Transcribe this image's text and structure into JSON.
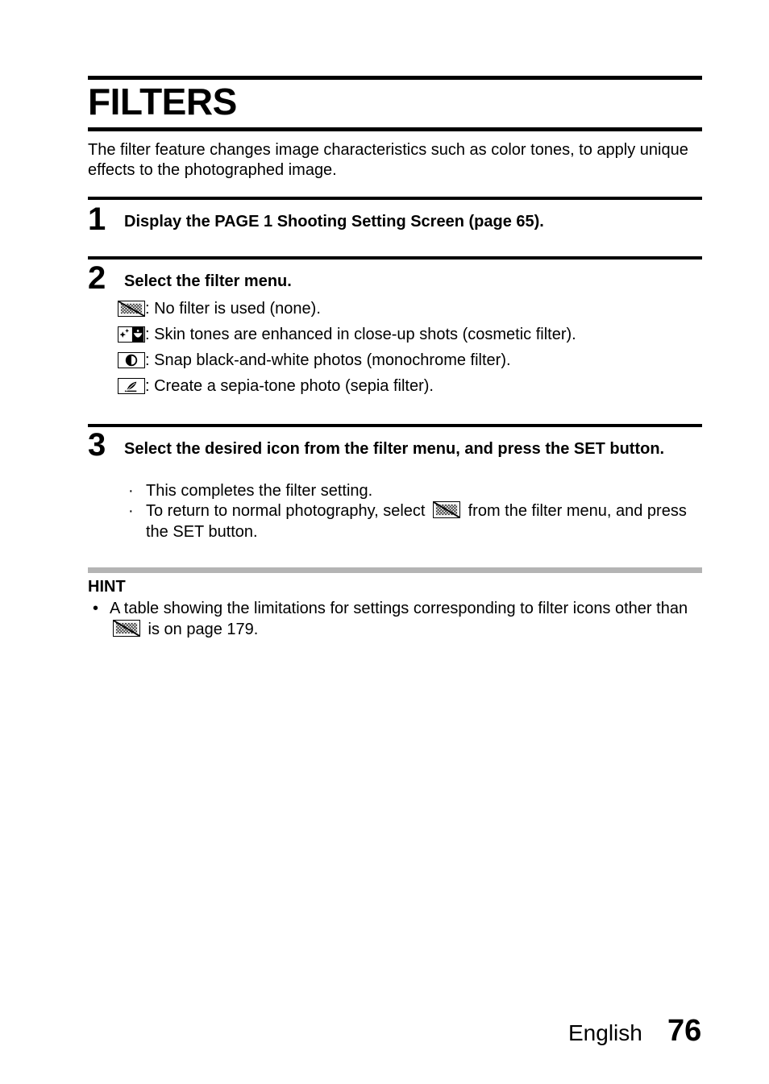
{
  "page": {
    "title": "FILTERS",
    "intro": "The filter feature changes image characteristics such as color tones, to apply unique effects to the photographed image.",
    "steps": [
      {
        "number": "1",
        "heading": "Display the PAGE 1 Shooting Setting Screen (page 65)."
      },
      {
        "number": "2",
        "heading": "Select the filter menu.",
        "items": [
          {
            "icon": "no-filter-icon",
            "text": ": No filter is used (none)."
          },
          {
            "icon": "cosmetic-filter-icon",
            "text": ": Skin tones are enhanced in close-up shots (cosmetic filter)."
          },
          {
            "icon": "monochrome-filter-icon",
            "text": ": Snap black-and-white photos (monochrome filter)."
          },
          {
            "icon": "sepia-filter-icon",
            "text": ": Create a sepia-tone photo (sepia filter)."
          }
        ]
      },
      {
        "number": "3",
        "heading": "Select the desired icon from the filter menu, and press the SET button.",
        "bullets": [
          {
            "text": "This completes the filter setting."
          },
          {
            "before": "To return to normal photography, select",
            "icon": "no-filter-icon",
            "after": "from the filter menu, and press the SET button."
          }
        ]
      }
    ],
    "hint": {
      "title": "HINT",
      "bullet": "•",
      "before": "A table showing the limitations for settings corresponding to filter icons other than",
      "icon": "no-filter-icon",
      "after": "is on page 179."
    },
    "footer": {
      "language": "English",
      "page_number": "76"
    },
    "bullet_char": "·"
  }
}
